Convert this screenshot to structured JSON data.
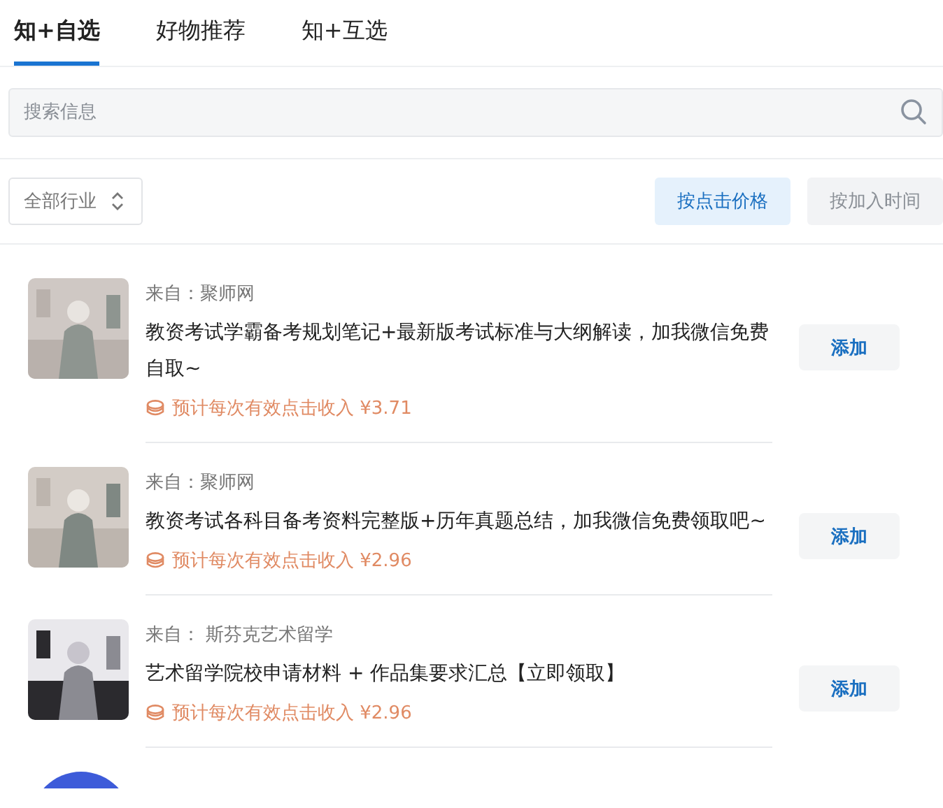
{
  "tabs": [
    {
      "label": "知+自选",
      "selected": true
    },
    {
      "label": "好物推荐",
      "selected": false
    },
    {
      "label": "知+互选",
      "selected": false
    }
  ],
  "search": {
    "placeholder": "搜索信息"
  },
  "filter": {
    "label": "全部行业"
  },
  "sort_buttons": [
    {
      "label": "按点击价格",
      "selected": true
    },
    {
      "label": "按加入时间",
      "selected": false
    }
  ],
  "items": [
    {
      "kind": "full",
      "source": "来自：聚师网",
      "title": "教资考试学霸备考规划笔记+最新版考试标准与大纲解读，加我微信免费自取~",
      "income": "预计每次有效点击收入 ¥3.71",
      "button": "添加"
    },
    {
      "kind": "full",
      "source": "来自：聚师网",
      "title": "教资考试各科目备考资料完整版+历年真题总结，加我微信免费领取吧~",
      "income": "预计每次有效点击收入 ¥2.96",
      "button": "添加"
    },
    {
      "kind": "full",
      "source": "来自： 斯芬克艺术留学",
      "title": "艺术留学院校申请材料 + 作品集要求汇总【立即领取】",
      "income": "预计每次有效点击收入 ¥2.96",
      "button": "添加"
    },
    {
      "kind": "cut"
    }
  ]
}
